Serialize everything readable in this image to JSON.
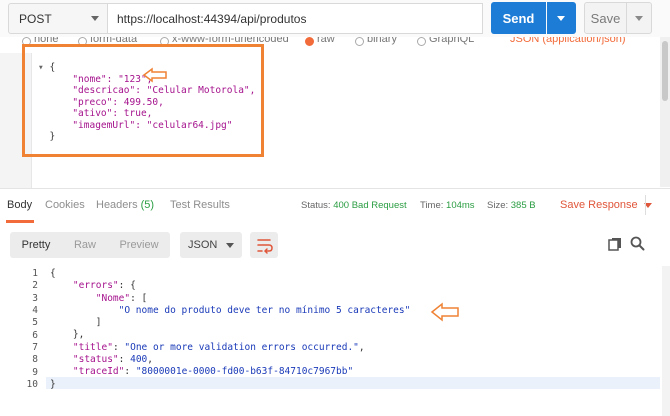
{
  "request": {
    "method": "POST",
    "url": "https://localhost:44394/api/produtos",
    "send_label": "Send",
    "save_label": "Save"
  },
  "body_types": {
    "items": [
      "none",
      "form-data",
      "x-www-form-urlencoded",
      "raw",
      "binary",
      "GraphQL"
    ],
    "selected": "raw",
    "content_type": "JSON (application/json)"
  },
  "request_body": {
    "lines": [
      "{",
      "    \"nome\": \"123\",",
      "    \"descricao\": \"Celular Motorola\",",
      "    \"preco\": 499.50,",
      "    \"ativo\": true,",
      "    \"imagemUrl\": \"celular64.jpg\"",
      "}"
    ]
  },
  "response_tabs": [
    {
      "label": "Body",
      "active": true
    },
    {
      "label": "Cookies",
      "active": false
    },
    {
      "label": "Headers",
      "count": "(5)",
      "active": false
    },
    {
      "label": "Test Results",
      "active": false
    }
  ],
  "response_meta": {
    "status_label": "Status:",
    "status_value": "400 Bad Request",
    "time_label": "Time:",
    "time_value": "104ms",
    "size_label": "Size:",
    "size_value": "385 B",
    "save_response_label": "Save Response"
  },
  "format_bar": {
    "modes": [
      "Pretty",
      "Raw",
      "Preview"
    ],
    "active_mode": "Pretty",
    "format": "JSON"
  },
  "response_body": {
    "line_numbers": [
      "1",
      "2",
      "3",
      "4",
      "5",
      "6",
      "7",
      "8",
      "9",
      "10"
    ]
  },
  "colors": {
    "accent": "#f26b3a",
    "send": "#1c7cd6",
    "annotation": "#ef8233",
    "status_ok_color": "#2a9d42"
  }
}
